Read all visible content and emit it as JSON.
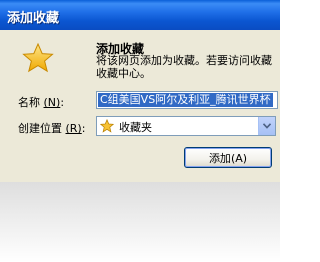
{
  "window": {
    "title": "添加收藏"
  },
  "dialog": {
    "heading": "添加收藏",
    "description_line1": "将该网页添加为收藏。若要访问收藏",
    "description_line2": "收藏中心。"
  },
  "form": {
    "name_label": "名称",
    "name_shortcut": "(N)",
    "name_value": "C组美国VS阿尔及利亚_腾讯世界杯",
    "location_label": "创建位置",
    "location_shortcut": "(R)",
    "location_value": "收藏夹"
  },
  "buttons": {
    "add_label": "添加",
    "add_shortcut": "(A)"
  },
  "colors": {
    "titlebar": "#0b56d1",
    "dialog_bg": "#ece9d8",
    "selection": "#316ac5",
    "star": "#f7c234"
  }
}
